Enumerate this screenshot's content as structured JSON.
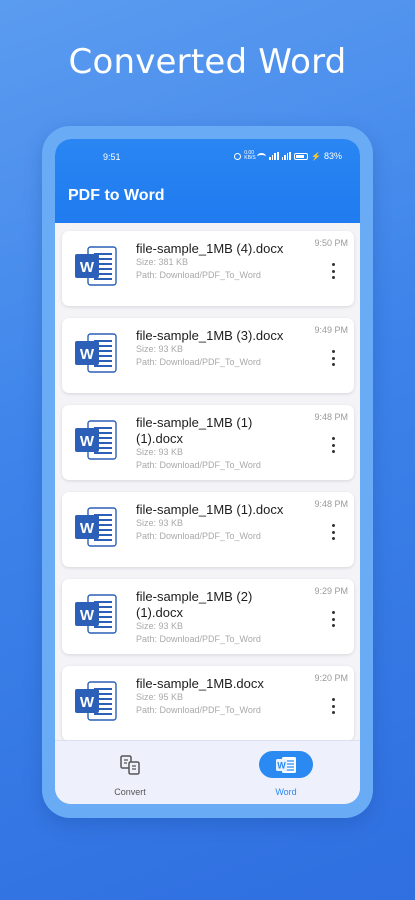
{
  "promo": {
    "title": "Converted Word"
  },
  "status_bar": {
    "time": "9:51",
    "speed": "0.00 KB/S",
    "battery": "83%"
  },
  "app_bar": {
    "title": "PDF to Word"
  },
  "files": [
    {
      "name": "file-sample_1MB (4).docx",
      "size": "Size: 381 KB",
      "path": "Path: Download/PDF_To_Word",
      "time": "9:50 PM"
    },
    {
      "name": "file-sample_1MB (3).docx",
      "size": "Size: 93 KB",
      "path": "Path: Download/PDF_To_Word",
      "time": "9:49 PM"
    },
    {
      "name": "file-sample_1MB (1) (1).docx",
      "size": "Size: 93 KB",
      "path": "Path: Download/PDF_To_Word",
      "time": "9:48 PM"
    },
    {
      "name": "file-sample_1MB (1).docx",
      "size": "Size: 93 KB",
      "path": "Path: Download/PDF_To_Word",
      "time": "9:48 PM"
    },
    {
      "name": "file-sample_1MB (2) (1).docx",
      "size": "Size: 93 KB",
      "path": "Path: Download/PDF_To_Word",
      "time": "9:29 PM"
    },
    {
      "name": "file-sample_1MB.docx",
      "size": "Size: 95 KB",
      "path": "Path: Download/PDF_To_Word",
      "time": "9:20 PM"
    }
  ],
  "bottom_nav": {
    "convert_label": "Convert",
    "word_label": "Word",
    "selected": "Word"
  },
  "colors": {
    "accent": "#2b89f2",
    "word_icon": "#2b5fb8",
    "background": "#3d83ea"
  },
  "icons": [
    "word-file-icon",
    "more-vertical-icon",
    "convert-icon",
    "word-icon"
  ]
}
